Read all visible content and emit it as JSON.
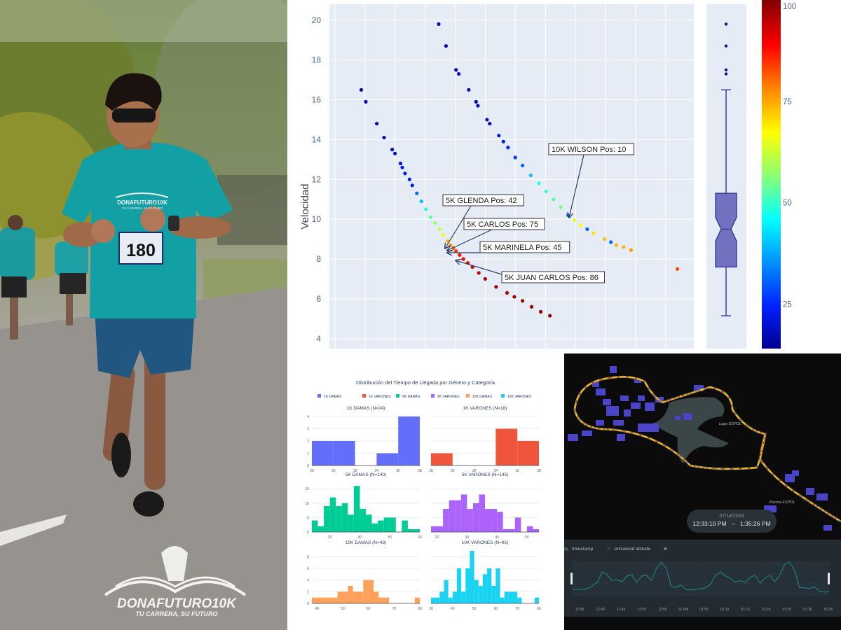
{
  "photo": {
    "bib_number": "180",
    "shirt_logo_text": "DONAFUTURO10K",
    "shirt_tagline": "TU CARRERA, SU FUTURO",
    "logo_title": "DONAFUTURO10K",
    "logo_tagline": "TU CARRERA, SU FUTURO"
  },
  "chart_data": [
    {
      "id": "velocity-scatter",
      "type": "scatter",
      "title": "",
      "xlabel": "",
      "ylabel": "Velocidad",
      "ylim": [
        3.5,
        20.8
      ],
      "yticks": [
        4,
        6,
        8,
        10,
        12,
        14,
        16,
        18,
        20
      ],
      "grid": true,
      "colorscale": "jet",
      "colorbar": {
        "range": [
          14,
          100
        ],
        "ticks": [
          25,
          50,
          75,
          100
        ],
        "placement": "right"
      },
      "series": [
        {
          "name": "5K",
          "points_xy_color": [
            [
              3.5,
              16.5,
              5
            ],
            [
              4.0,
              15.9,
              5
            ],
            [
              5.2,
              14.8,
              5
            ],
            [
              6.0,
              14.1,
              5
            ],
            [
              6.9,
              13.5,
              5
            ],
            [
              7.2,
              13.3,
              5
            ],
            [
              7.8,
              12.8,
              8
            ],
            [
              8.0,
              12.6,
              10
            ],
            [
              8.3,
              12.3,
              10
            ],
            [
              8.8,
              12.0,
              10
            ],
            [
              9.1,
              11.7,
              12
            ],
            [
              9.6,
              11.3,
              20
            ],
            [
              10.1,
              10.9,
              30
            ],
            [
              10.6,
              10.5,
              40
            ],
            [
              11.1,
              10.1,
              45
            ],
            [
              11.6,
              9.8,
              50
            ],
            [
              12.1,
              9.5,
              55
            ],
            [
              12.5,
              9.2,
              60
            ],
            [
              13.0,
              8.9,
              70
            ],
            [
              13.3,
              8.7,
              72
            ],
            [
              13.6,
              8.55,
              78
            ],
            [
              13.9,
              8.4,
              82
            ],
            [
              14.3,
              8.2,
              85
            ],
            [
              14.7,
              8.0,
              88
            ],
            [
              15.2,
              7.8,
              90
            ],
            [
              15.7,
              7.6,
              92
            ],
            [
              16.4,
              7.3,
              93
            ],
            [
              17.1,
              7.0,
              95
            ],
            [
              18.3,
              6.6,
              96
            ],
            [
              19.5,
              6.3,
              96
            ],
            [
              20.3,
              6.1,
              97
            ],
            [
              21.2,
              5.9,
              97
            ],
            [
              22.2,
              5.6,
              98
            ],
            [
              23.2,
              5.35,
              98
            ],
            [
              24.2,
              5.15,
              99
            ]
          ],
          "annotations": [
            {
              "label": "5K GLENDA Pos: 42"
            },
            {
              "label": "5K CARLOS Pos: 75"
            },
            {
              "label": "5K MARINELA Pos: 45"
            },
            {
              "label": "5K JUAN CARLOS Pos: 86"
            }
          ]
        },
        {
          "name": "10K",
          "points_xy_color": [
            [
              12.0,
              19.8,
              5
            ],
            [
              12.8,
              18.7,
              5
            ],
            [
              13.9,
              17.5,
              5
            ],
            [
              14.2,
              17.3,
              5
            ],
            [
              15.3,
              16.5,
              5
            ],
            [
              16.1,
              15.9,
              5
            ],
            [
              16.3,
              15.7,
              5
            ],
            [
              17.3,
              15.0,
              5
            ],
            [
              17.6,
              14.8,
              5
            ],
            [
              18.6,
              14.2,
              8
            ],
            [
              19.1,
              13.9,
              10
            ],
            [
              19.6,
              13.6,
              12
            ],
            [
              20.4,
              13.1,
              15
            ],
            [
              21.2,
              12.7,
              20
            ],
            [
              22.1,
              12.2,
              30
            ],
            [
              23.0,
              11.8,
              40
            ],
            [
              23.8,
              11.4,
              42
            ],
            [
              24.6,
              11.0,
              45
            ],
            [
              25.4,
              10.6,
              48
            ],
            [
              26.2,
              10.2,
              20
            ],
            [
              26.9,
              9.95,
              60
            ],
            [
              27.6,
              9.7,
              62
            ],
            [
              28.3,
              9.5,
              20
            ],
            [
              29.0,
              9.3,
              65
            ],
            [
              30.2,
              9.0,
              68
            ],
            [
              30.9,
              8.85,
              20
            ],
            [
              31.5,
              8.7,
              70
            ],
            [
              32.3,
              8.6,
              70
            ],
            [
              33.1,
              8.45,
              72
            ],
            [
              38.2,
              7.5,
              80
            ]
          ],
          "annotations": [
            {
              "label": "10K WILSON Pos: 10"
            }
          ]
        }
      ]
    },
    {
      "id": "velocity-boxplot",
      "type": "box",
      "notched": true,
      "ylim": [
        3.5,
        20.8
      ],
      "min": 5.15,
      "q1": 7.6,
      "median": 9.5,
      "q3": 11.3,
      "max": 16.5,
      "outliers": [
        17.3,
        17.5,
        18.7,
        19.8
      ],
      "color": "#3f3f9f"
    },
    {
      "id": "finish-time-histograms",
      "type": "bar",
      "title": "Distribución del Tiempo de Llegada por Género y Categoría",
      "legend": [
        "1K DAMAS",
        "1K VARONES",
        "5K DAMAS",
        "5K VARONES",
        "10K DAMAS",
        "10K VARONES"
      ],
      "legend_placement": "top",
      "subplots": [
        {
          "title": "1K DAMAS (N=24)",
          "color": "#636efa",
          "bin_start": 28,
          "bin_width": 2,
          "counts": [
            2,
            2,
            0,
            1,
            4
          ],
          "xlim": [
            28,
            38
          ],
          "xticks": [
            28,
            30,
            32,
            34,
            36,
            38
          ],
          "ylim": [
            0,
            4
          ],
          "yticks": [
            0,
            1,
            2,
            3,
            4
          ]
        },
        {
          "title": "1K VARONES (N=18)",
          "color": "#ef553b",
          "bin_start": 28,
          "bin_width": 2,
          "counts": [
            1,
            0,
            0,
            3,
            2
          ],
          "xlim": [
            28,
            38
          ],
          "xticks": [
            28,
            30,
            32,
            34,
            36,
            38
          ],
          "ylim": [
            0,
            4
          ],
          "yticks": []
        },
        {
          "title": "5K DAMAS (N=140)",
          "color": "#00cc96",
          "bin_start": 24,
          "bin_width": 2,
          "counts": [
            4,
            2,
            9,
            12,
            9,
            10,
            6,
            16,
            8,
            6,
            3,
            4,
            5,
            5,
            0,
            4,
            1,
            1
          ],
          "xlim": [
            24,
            60
          ],
          "xticks": [
            30,
            40,
            50,
            60
          ],
          "ylim": [
            0,
            17
          ],
          "yticks": [
            0,
            5,
            10,
            15
          ]
        },
        {
          "title": "5K VARONES (N=145)",
          "color": "#ab63fa",
          "bin_start": 18,
          "bin_width": 2,
          "counts": [
            2,
            2,
            8,
            11,
            11,
            13,
            8,
            10,
            13,
            8,
            8,
            7,
            1,
            1,
            5,
            0,
            2,
            1
          ],
          "xlim": [
            18,
            54
          ],
          "xticks": [
            20,
            30,
            40,
            50
          ],
          "ylim": [
            0,
            17
          ],
          "yticks": []
        },
        {
          "title": "10K DAMAS (N=43)",
          "color": "#ffa15a",
          "bin_start": 38,
          "bin_width": 2,
          "counts": [
            1,
            1,
            1,
            1,
            1,
            2,
            2,
            3,
            2,
            2,
            4,
            4,
            2,
            1,
            1,
            0,
            0,
            0,
            0,
            0,
            1
          ],
          "xlim": [
            38,
            80
          ],
          "xticks": [
            40,
            50,
            60,
            70,
            80
          ],
          "ylim": [
            0,
            9
          ],
          "yticks": [
            0,
            2,
            4,
            6,
            8
          ]
        },
        {
          "title": "10K VARONES (N=95)",
          "color": "#19d3f3",
          "bin_start": 30,
          "bin_width": 2,
          "counts": [
            1,
            1,
            2,
            4,
            1,
            2,
            6,
            2,
            6,
            9,
            4,
            3,
            5,
            6,
            3,
            6,
            1,
            2,
            2,
            2,
            1,
            0,
            0,
            0,
            1
          ],
          "xlim": [
            30,
            80
          ],
          "xticks": [
            30,
            40,
            50,
            60,
            70,
            80
          ],
          "ylim": [
            0,
            9
          ],
          "yticks": []
        }
      ]
    },
    {
      "id": "altitude-timeline",
      "type": "line",
      "title": "",
      "series_label": "enhanced altitude",
      "x_label": "timestamp",
      "xticks": [
        "12:35",
        "12:40",
        "12:45",
        "12:50",
        "12:55",
        "01 PM",
        "01:05",
        "01:10",
        "01:15",
        "01:20",
        "01:25",
        "01:30",
        "01:35"
      ],
      "values": [
        20,
        20,
        20,
        22,
        30,
        40,
        70,
        62,
        45,
        48,
        42,
        58,
        62,
        40,
        58,
        60,
        45,
        80,
        98,
        80,
        28,
        26,
        32,
        20,
        18,
        20,
        22,
        25,
        35,
        60,
        70,
        58,
        52,
        40,
        45,
        40,
        55,
        60,
        38,
        52,
        60,
        42,
        60,
        92,
        98,
        75,
        25,
        25,
        22,
        28,
        15,
        12,
        14
      ]
    }
  ],
  "map": {
    "labels": [
      "Lago ESPOL",
      "Piscina ESPOL"
    ],
    "date": "07/14/2024",
    "time_start": "12:33:10 PM",
    "time_separator": "–",
    "time_end": "1:35:26 PM",
    "timeline_field_label": "timestamp",
    "timeline_series_label": "enhanced altitude",
    "accent_track": "#f2c300",
    "accent_line": "#1e8c89"
  }
}
